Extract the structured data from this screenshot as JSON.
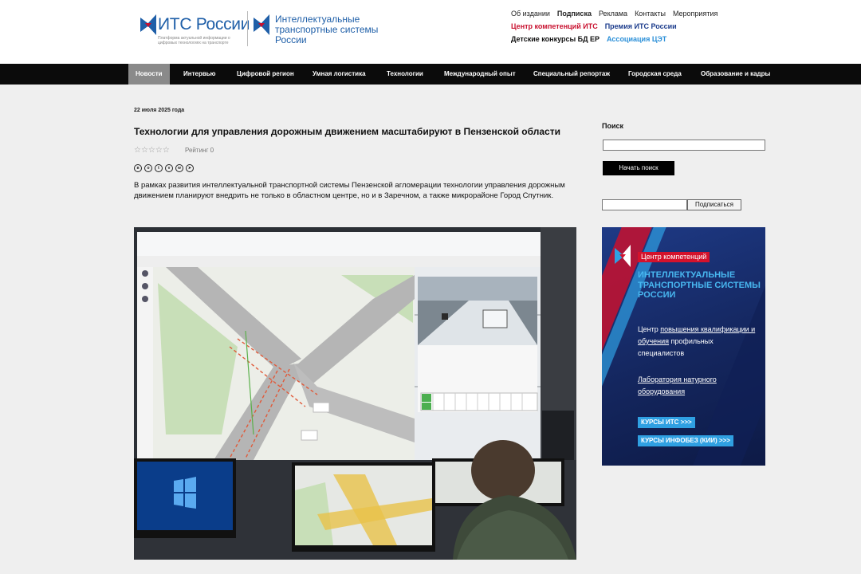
{
  "header": {
    "logo1_title": "ИТС России",
    "logo1_tagline": "Платформа актуальной информации о цифровых технологиях на транспорте",
    "logo2_title": "Интеллектуальные транспортные системы России",
    "links_row1": [
      "Об издании",
      "Подписка",
      "Реклама",
      "Контакты",
      "Мероприятия"
    ],
    "links_row2": [
      "Центр компетенций ИТС",
      "Премия ИТС России"
    ],
    "links_row3": [
      "Детские конкурсы БД ЕР",
      "Ассоциация ЦЭТ"
    ],
    "colors": {
      "brand_blue": "#1f5fa8",
      "red": "#c8102e",
      "dark_blue": "#1c3c8c",
      "light_blue": "#2a8fd8"
    }
  },
  "nav": {
    "items": [
      "Новости",
      "Интервью",
      "Цифровой регион",
      "Умная логистика",
      "Технологии",
      "Международный опыт",
      "Специальный репортаж",
      "Городская среда",
      "Образование и кадры"
    ]
  },
  "article": {
    "date": "22 июля 2025 года",
    "title": "Технологии для управления дорожным движением масштабируют в Пензенской области",
    "stars": "☆☆☆☆☆",
    "rating": "Рейтинг 0",
    "share_icons": [
      "vk-icon",
      "ok-icon",
      "twitter-icon",
      "viber-icon",
      "whatsapp-icon",
      "telegram-icon"
    ],
    "lead": "В рамках развития интеллектуальной транспортной системы Пензенской агломерации технологии управления дорожным движением планируют внедрить не только в областном центре, но и в Заречном, а также микрорайоне Город Спутник."
  },
  "sidebar": {
    "search_label": "Поиск",
    "search_value": "",
    "search_button": "Начать поиск",
    "subscribe_value": "",
    "subscribe_button": "Подписаться",
    "banner": {
      "tag": "Центр компетенций",
      "title": "ИНТЕЛЛЕКТУАЛЬНЫЕ ТРАНСПОРТНЫЕ СИСТЕМЫ РОССИИ",
      "text1_pre": "Центр ",
      "text1_link": "повышения квалификации и обучения",
      "text1_post": " профильных специалистов",
      "text2": "Лаборатория натурного оборудования",
      "btn1": "КУРСЫ ИТС >>>",
      "btn2": "КУРСЫ ИНФОБЕЗ (КИИ) >>>"
    }
  }
}
